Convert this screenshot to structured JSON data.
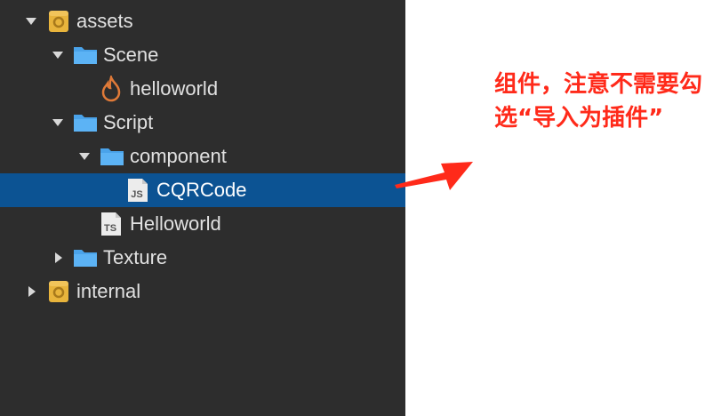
{
  "tree": {
    "items": [
      {
        "label": "assets",
        "icon": "database-icon",
        "expanded": true
      },
      {
        "label": "Scene",
        "icon": "folder-icon",
        "expanded": true
      },
      {
        "label": "helloworld",
        "icon": "fire-scene-icon"
      },
      {
        "label": "Script",
        "icon": "folder-icon",
        "expanded": true
      },
      {
        "label": "component",
        "icon": "folder-icon",
        "expanded": true
      },
      {
        "label": "CQRCode",
        "icon": "js-file-icon",
        "badge": "JS",
        "selected": true
      },
      {
        "label": "Helloworld",
        "icon": "ts-file-icon",
        "badge": "TS"
      },
      {
        "label": "Texture",
        "icon": "folder-icon",
        "expanded": false
      },
      {
        "label": "internal",
        "icon": "database-icon",
        "expanded": false
      }
    ]
  },
  "annotation": {
    "text": "组件，注意不需要勾选“导入为插件”",
    "color": "#ff2a1a"
  },
  "colors": {
    "panel": "#2d2d2d",
    "selected": "#0c5393",
    "folder": "#4aa3ea",
    "database": "#e8b43c"
  }
}
